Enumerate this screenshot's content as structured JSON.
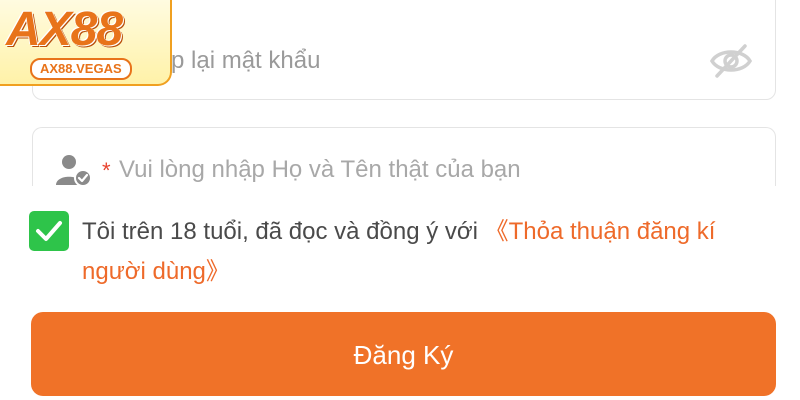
{
  "logo": {
    "main": "AX88",
    "sub": "AX88.VEGAS"
  },
  "confirm_password": {
    "value": "p lại mật khẩu",
    "icon": "eye-off-icon"
  },
  "full_name": {
    "required_mark": "*",
    "placeholder": "Vui lòng nhập Họ và Tên thật của bạn",
    "icon": "user-verified-icon"
  },
  "agreement": {
    "checked": true,
    "text": "Tôi trên 18 tuổi, đã đọc và đồng ý với ",
    "link": "《Thỏa thuận đăng kí người dùng》"
  },
  "register_button": {
    "label": "Đăng Ký"
  },
  "colors": {
    "accent": "#f07228",
    "check": "#2ec44a",
    "link": "#ee6a2a",
    "required": "#e8432f"
  }
}
